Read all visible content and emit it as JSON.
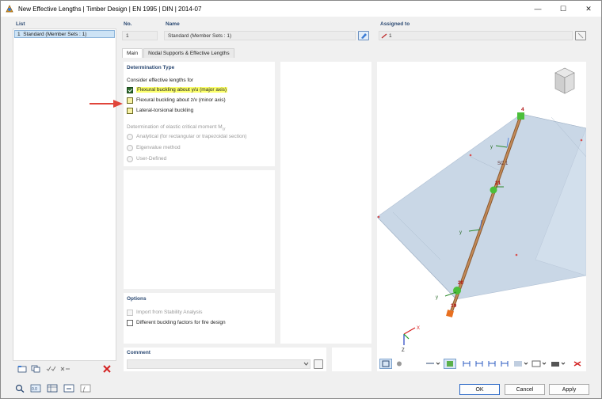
{
  "window": {
    "title": "New Effective Lengths | Timber Design | EN 1995 | DIN | 2014-07",
    "buttons": {
      "minimize": "—",
      "maximize": "☐",
      "close": "✕"
    }
  },
  "list": {
    "header": "List",
    "items": [
      {
        "number": "1",
        "label": "Standard (Member Sets : 1)"
      }
    ]
  },
  "no": {
    "header": "No.",
    "value": "1"
  },
  "name": {
    "header": "Name",
    "value": "Standard (Member Sets : 1)"
  },
  "assigned": {
    "header": "Assigned to",
    "value": "1"
  },
  "tabs": [
    "Main",
    "Nodal Supports & Effective Lengths"
  ],
  "determination": {
    "header": "Determination Type",
    "consider_label": "Consider effective lengths for",
    "options": [
      {
        "label": "Flexural buckling about y/u (major axis)",
        "checked": true,
        "highlight": true
      },
      {
        "label": "Flexural buckling about z/v (minor axis)",
        "checked": false,
        "highlight": false
      },
      {
        "label": "Lateral-torsional buckling",
        "checked": false,
        "highlight": false
      }
    ],
    "critical_moment_label": "Determination of elastic critical moment M",
    "critical_moment_sub": "cr",
    "methods": [
      "Analytical (for rectangular or trapezoidal section)",
      "Eigenvalue method",
      "User-Defined"
    ]
  },
  "options": {
    "header": "Options",
    "items": [
      "Import from Stability Analysis",
      "Different buckling factors for fire design"
    ]
  },
  "comment": {
    "header": "Comment",
    "value": ""
  },
  "model": {
    "node_labels": [
      "4",
      "21",
      "20",
      "19"
    ],
    "member_label": "SC 1",
    "axis_labels": {
      "x": "X",
      "z": "Z",
      "y": "Y"
    }
  },
  "footer": {
    "ok": "OK",
    "cancel": "Cancel",
    "apply": "Apply"
  },
  "colors": {
    "accent": "#2c4a73",
    "highlight": "#fbff6b",
    "member": "#b07a4a",
    "node": "#4bbf3a",
    "surface": "#c9d7e6",
    "delete": "#d32020"
  }
}
